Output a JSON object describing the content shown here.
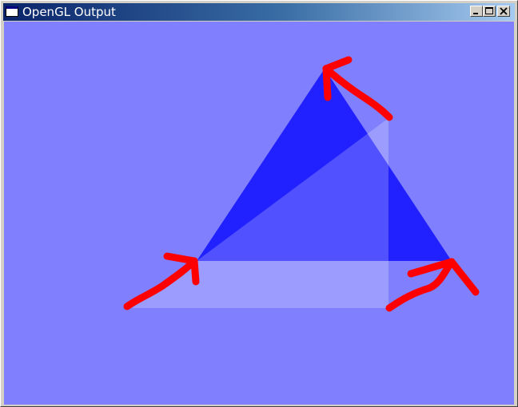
{
  "window": {
    "title": "OpenGL Output",
    "icon": "window-app-icon"
  },
  "titlebar_buttons": [
    {
      "name": "minimize-button",
      "icon": "minimize-icon"
    },
    {
      "name": "maximize-button",
      "icon": "maximize-icon"
    },
    {
      "name": "close-button",
      "icon": "close-icon"
    }
  ],
  "canvas": {
    "clear_color": "#8080ff",
    "shapes": [
      {
        "name": "blue-triangle",
        "color": "#2121ff"
      },
      {
        "name": "translucent-white-triangle",
        "color": "#ffffff",
        "opacity": 0.22
      },
      {
        "name": "translucent-white-quad",
        "color": "#ffffff",
        "opacity": 0.22
      }
    ],
    "annotation_color": "#ff0000",
    "annotations": [
      "arrow-annotation-top",
      "arrow-annotation-left",
      "arrow-annotation-right"
    ]
  }
}
